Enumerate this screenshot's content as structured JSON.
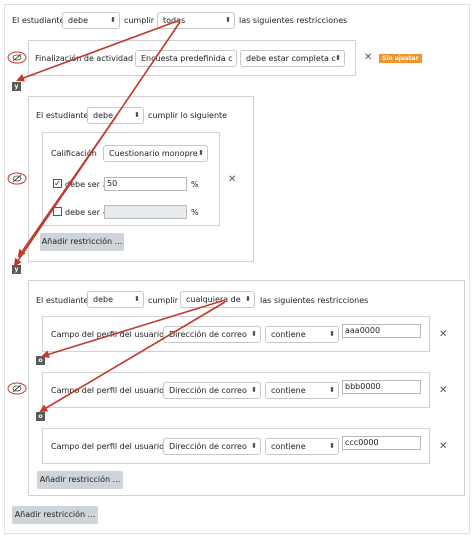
{
  "top": {
    "student_label": "El estudiante",
    "must_select": "debe",
    "fulfill_label": "cumplir",
    "all_select": "todas",
    "restrictions_label": "las siguientes restricciones"
  },
  "completion": {
    "label": "Finalización de actividad",
    "activity_select": "Encuesta predefinida c",
    "state_select": "debe estar completa c",
    "badge": "Sin ajustar"
  },
  "op_and": "y",
  "op_or": "o",
  "nested": {
    "student_label": "El estudiante",
    "must_select": "debe",
    "fulfill_label": "cumplir lo siguiente",
    "grade_label": "Calificación",
    "grade_item_select": "Cuestionario monopre",
    "must_ge_label": "debe ser ≥",
    "ge_value": "50",
    "percent": "%",
    "must_lt_label": "debe ser <",
    "lt_value": "",
    "add_button": "Añadir restricción ..."
  },
  "profile_group": {
    "student_label": "El estudiante",
    "must_select": "debe",
    "fulfill_label": "cumplir",
    "any_select": "cualquiera de",
    "restrictions_label": "las siguientes restricciones",
    "field_label": "Campo del perfil del usuario",
    "rows": [
      {
        "field_select": "Dirección de correo",
        "operator_select": "contiene",
        "value": "aaa0000"
      },
      {
        "field_select": "Dirección de correo",
        "operator_select": "contiene",
        "value": "bbb0000"
      },
      {
        "field_select": "Dirección de correo",
        "operator_select": "contiene",
        "value": "ccc0000"
      }
    ],
    "add_button": "Añadir restricción ..."
  },
  "main_add_button": "Añadir restricción ...",
  "colors": {
    "annotation": "#c0392b",
    "badge": "#f0932b",
    "operator": "#5a5a5a",
    "button": "#ced4da"
  },
  "icons": [
    "eye-slash-icon",
    "chevron-down-icon",
    "close-icon",
    "checkbox-icon"
  ]
}
